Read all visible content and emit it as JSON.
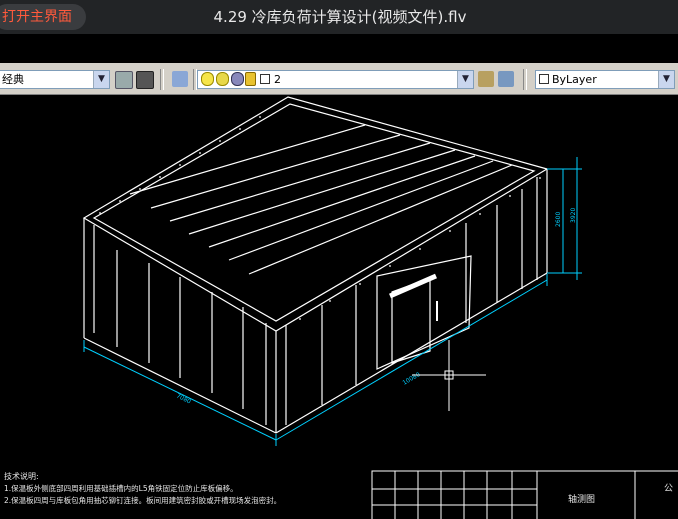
{
  "player": {
    "back_label": "打开主界面",
    "video_title": "4.29 冷库负荷计算设计(视频文件).flv"
  },
  "toolbar": {
    "workspace": "经典",
    "layer_name": "2",
    "linetype": "ByLayer"
  },
  "drawing": {
    "dimensions": {
      "length": "7080",
      "width": "10080",
      "height_outer": "3920",
      "height_inner": "2600"
    },
    "notes_title": "技术说明:",
    "notes": [
      "1.保温板外侧底部四周利用基础插槽内的L5角铁固定位防止库板偏移。",
      "2.保温板四周与库板包角用抽芯铆钉连接。板间用建筑密封胶或开槽现场发泡密封。"
    ],
    "title_block": {
      "view_label": "轴测图",
      "company_label": "公"
    }
  },
  "colors": {
    "background": "#000000",
    "dimension": "#00d0ff",
    "outline": "#ffffff"
  }
}
